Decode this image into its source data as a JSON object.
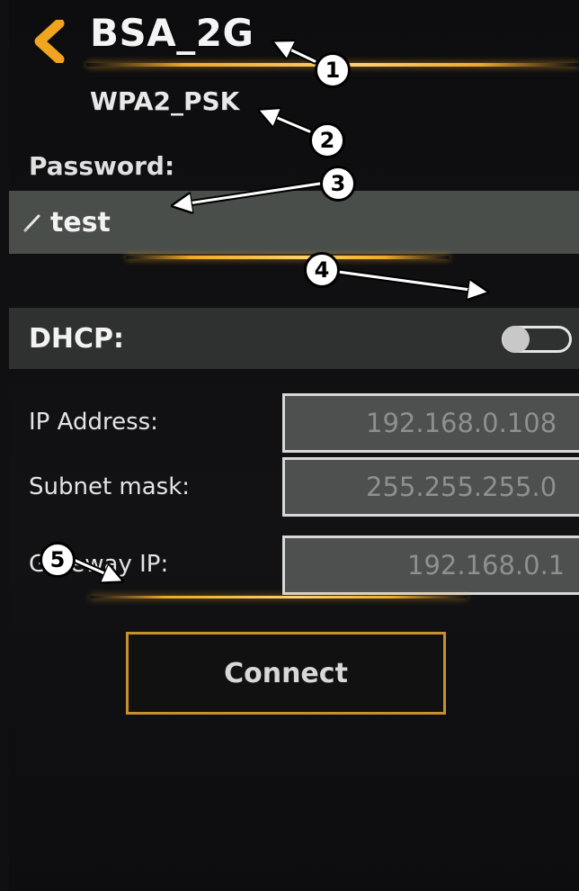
{
  "header": {
    "title": "BSA_2G",
    "back_icon": "chevron-left-icon"
  },
  "network": {
    "security": "WPA2_PSK"
  },
  "password": {
    "label": "Password:",
    "value": "test",
    "edit_icon": "pencil-icon"
  },
  "dhcp": {
    "label": "DHCP:",
    "enabled": false
  },
  "fields": {
    "ip_label": "IP Address:",
    "ip_value": "192.168.0.108",
    "subnet_label": "Subnet mask:",
    "subnet_value": "255.255.255.0",
    "gateway_label": "Gateway IP:",
    "gateway_value": "192.168.0.1"
  },
  "connect_label": "Connect",
  "callouts": [
    "1",
    "2",
    "3",
    "4",
    "5"
  ],
  "colors": {
    "accent": "#f0a82a",
    "background": "#101012",
    "field": "#4a4e4b"
  }
}
